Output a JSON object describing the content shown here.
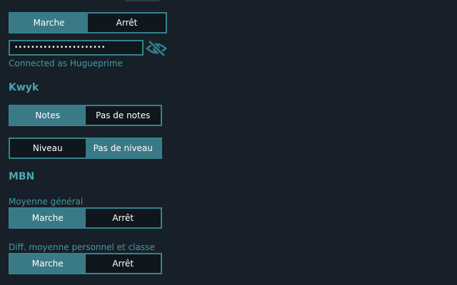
{
  "top_toggle": {
    "on_label": "Marche",
    "off_label": "Arrêt",
    "selected": "on"
  },
  "password": {
    "value": "••••••••••••••••••••••",
    "visibility_icon": "eye-off-icon"
  },
  "status_text": "Connected as Hugueprime",
  "kwyk": {
    "heading": "Kwyk",
    "notes_toggle": {
      "on_label": "Notes",
      "off_label": "Pas de notes",
      "selected": "on"
    },
    "niveau_toggle": {
      "on_label": "Niveau",
      "off_label": "Pas de niveau",
      "selected": "off"
    }
  },
  "mbn": {
    "heading": "MBN",
    "moyenne": {
      "label": "Moyenne général",
      "toggle": {
        "on_label": "Marche",
        "off_label": "Arrêt",
        "selected": "on"
      }
    },
    "diff": {
      "label": "Diff. moyenne personnel et classe",
      "toggle": {
        "on_label": "Marche",
        "off_label": "Arrêt",
        "selected": "on"
      }
    }
  },
  "colors": {
    "background": "#172028",
    "accent": "#3a7986",
    "border": "#35818e",
    "label_text": "#3f9aa6",
    "heading_text": "#4aa6b3"
  }
}
